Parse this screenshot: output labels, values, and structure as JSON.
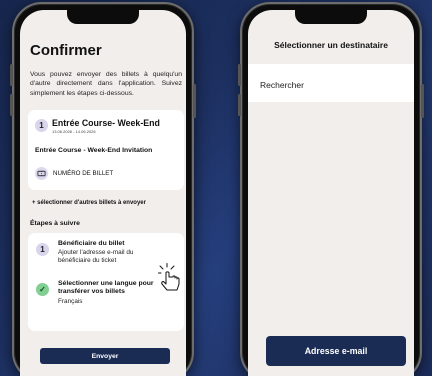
{
  "left_screen": {
    "title": "Confirmer",
    "description": "Vous pouvez envoyer des billets à quelqu'un d'autre directement dans l'application. Suivez simplement les étapes ci-dessous.",
    "ticket": {
      "index": "1",
      "name": "Entrée Course- Week-End",
      "date": "13.06.2026 - 14.06.2026",
      "subtitle": "Entrée Course - Week-End Invitation",
      "ticket_number_label": "NUMÉRO DE BILLET",
      "ticket_icon": "ticket-icon"
    },
    "more_tickets_link": "+ sélectionner d'autres billets à envoyer",
    "steps_title": "Étapes à suivre",
    "steps": [
      {
        "index": "1",
        "title": "Bénéficiaire du billet",
        "description": "Ajouter l'adresse e-mail du bénéficiaire du ticket"
      },
      {
        "icon": "check-icon",
        "check_glyph": "✓",
        "title": "Sélectionner une langue pour transférer vos billets",
        "value": "Français"
      }
    ],
    "send_button": "Envoyer"
  },
  "right_screen": {
    "header": "Sélectionner un destinataire",
    "search_placeholder": "Rechercher",
    "email_button": "Adresse e-mail"
  },
  "colors": {
    "background": "#1a2a52",
    "screen": "#f2eeec",
    "primary_button": "#1b2c54",
    "badge": "#d8d5ec",
    "check": "#82cf94"
  }
}
